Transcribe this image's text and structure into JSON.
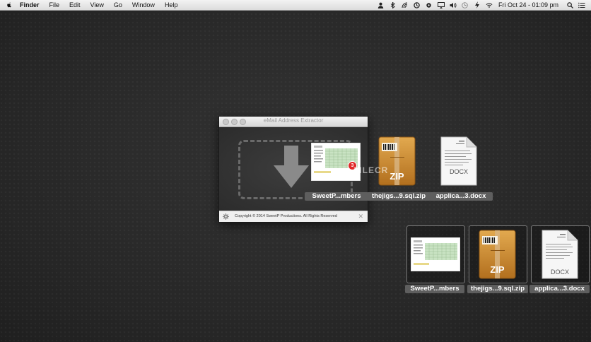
{
  "menubar": {
    "items": [
      "Finder",
      "File",
      "Edit",
      "View",
      "Go",
      "Window",
      "Help"
    ],
    "clock": "Fri Oct 24 - 01:09 pm",
    "status_icons": [
      "user-icon",
      "bluetooth-icon",
      "sync-icon",
      "backup-icon",
      "gear-icon",
      "airplay-icon",
      "volume-icon",
      "time-machine-icon",
      "power-icon",
      "wifi-icon",
      "search-icon",
      "list-icon"
    ]
  },
  "window": {
    "title": "eMail Address Extractor",
    "copyright": "Copyright © 2014 SweetP Productions. All Rights Reserved"
  },
  "drag_group": {
    "badge_count": "3",
    "labels": [
      "SweetP...mbers",
      "thejigs...9.sql.zip",
      "applica...3.docx"
    ],
    "zip_text": "ZIP",
    "docx_text": "DOCX"
  },
  "desktop_files": {
    "labels": [
      "SweetP...mbers",
      "thejigs...9.sql.zip",
      "applica...3.docx"
    ],
    "zip_text": "ZIP",
    "docx_text": "DOCX"
  },
  "watermark": "FILECR"
}
